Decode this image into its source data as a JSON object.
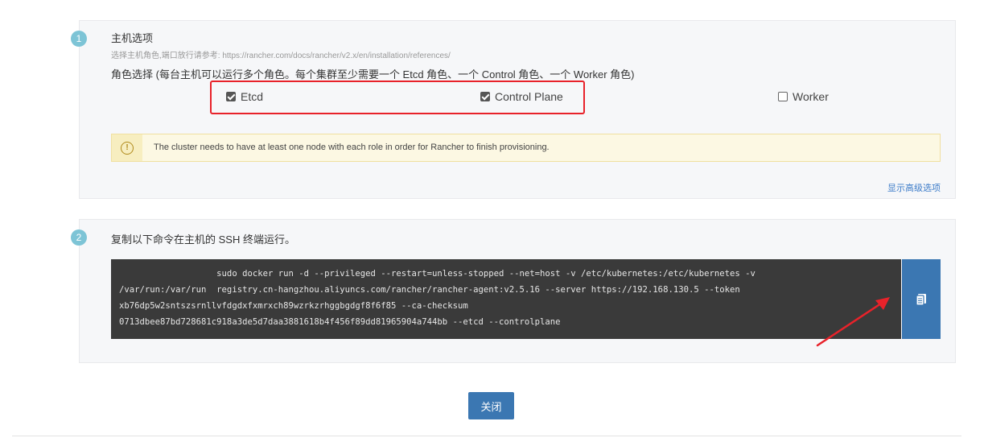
{
  "steps": {
    "step1_number": "1",
    "step2_number": "2"
  },
  "host_options": {
    "title": "主机选项",
    "hint": "选择主机角色,端口放行请参考: https://rancher.com/docs/rancher/v2.x/en/installation/references/",
    "role_description": "角色选择 (每台主机可以运行多个角色。每个集群至少需要一个 Etcd 角色、一个 Control 角色、一个 Worker 角色)",
    "roles": [
      {
        "label": "Etcd",
        "checked": true
      },
      {
        "label": "Control Plane",
        "checked": true
      },
      {
        "label": "Worker",
        "checked": false
      }
    ],
    "warning": "The cluster needs to have at least one node with each role in order for Rancher to finish provisioning.",
    "advanced_link": "显示高级选项"
  },
  "command_section": {
    "title": "复制以下命令在主机的 SSH 终端运行。",
    "command_lines": [
      "                   sudo docker run -d --privileged --restart=unless-stopped --net=host -v /etc/kubernetes:/etc/kubernetes -v",
      "/var/run:/var/run  registry.cn-hangzhou.aliyuncs.com/rancher/rancher-agent:v2.5.16 --server https://192.168.130.5 --token",
      "xb76dp5w2sntszsrnllvfdgdxfxmrxch89wzrkzrhggbgdgf8f6f85 --ca-checksum",
      "0713dbee87bd728681c918a3de5d7daa3881618b4f456f89dd81965904a744bb --etcd --controlplane"
    ]
  },
  "footer": {
    "close_label": "关闭"
  },
  "colors": {
    "accent": "#3b77b2",
    "highlight": "#e8222a",
    "step_badge": "#7dc4d6"
  },
  "icons": {
    "copy": "clipboard-icon",
    "warning": "info-circle-icon"
  }
}
